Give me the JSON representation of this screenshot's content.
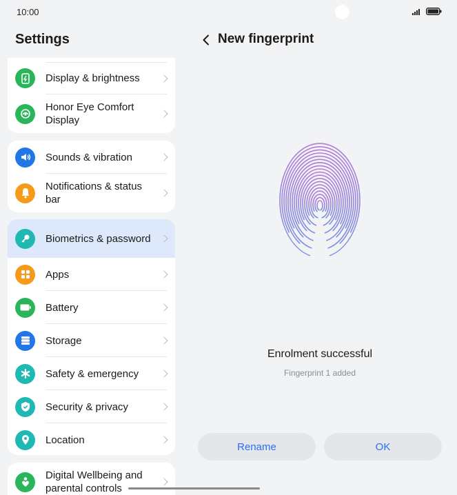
{
  "status_bar": {
    "time": "10:00"
  },
  "sidebar": {
    "title": "Settings",
    "groups": [
      {
        "items": [
          {
            "label": "Display & brightness",
            "icon": "display-icon",
            "color": "#2bb55a"
          },
          {
            "label": "Honor Eye Comfort Display",
            "icon": "eye-comfort-icon",
            "color": "#2bb55a"
          }
        ]
      },
      {
        "items": [
          {
            "label": "Sounds & vibration",
            "icon": "speaker-icon",
            "color": "#2176e8"
          },
          {
            "label": "Notifications & status bar",
            "icon": "bell-icon",
            "color": "#f59a1a"
          }
        ]
      },
      {
        "items": [
          {
            "label": "Biometrics & password",
            "icon": "key-icon",
            "color": "#1fb8b3",
            "selected": true
          },
          {
            "label": "Apps",
            "icon": "apps-icon",
            "color": "#f59a1a"
          },
          {
            "label": "Battery",
            "icon": "battery-icon",
            "color": "#2bb55a"
          },
          {
            "label": "Storage",
            "icon": "storage-icon",
            "color": "#2176e8"
          },
          {
            "label": "Safety & emergency",
            "icon": "asterisk-icon",
            "color": "#1fb8b3"
          },
          {
            "label": "Security & privacy",
            "icon": "shield-icon",
            "color": "#1fb8b3"
          },
          {
            "label": "Location",
            "icon": "location-pin-icon",
            "color": "#1fb8b3"
          }
        ]
      },
      {
        "items": [
          {
            "label": "Digital Wellbeing and parental controls",
            "icon": "wellbeing-icon",
            "color": "#2bb55a"
          }
        ]
      }
    ]
  },
  "main": {
    "title": "New fingerprint",
    "fingerprint_gradient": [
      "#b57ad9",
      "#7e8fe0"
    ],
    "status": "Enrolment successful",
    "detail": "Fingerprint 1 added",
    "buttons": {
      "rename": "Rename",
      "ok": "OK"
    },
    "accent": "#256fff"
  }
}
